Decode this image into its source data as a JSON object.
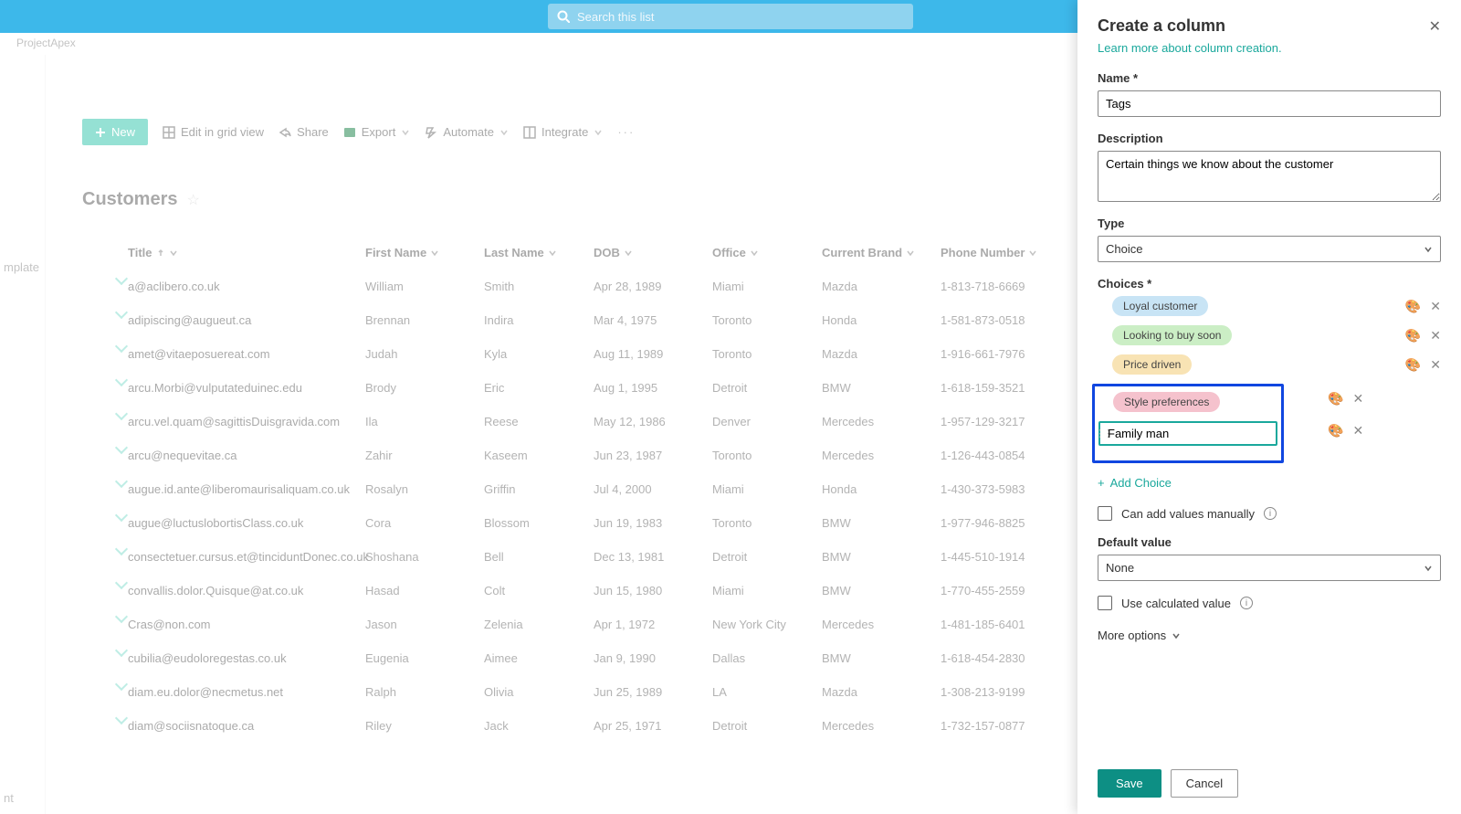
{
  "topbar": {
    "search_placeholder": "Search this list"
  },
  "breadcrumb": "ProjectApex",
  "left": {
    "mplate": "mplate",
    "nt": "nt"
  },
  "toolbar": {
    "new": "New",
    "grid": "Edit in grid view",
    "share": "Share",
    "export": "Export",
    "automate": "Automate",
    "integrate": "Integrate"
  },
  "list_heading": "Customers",
  "columns": [
    "Title",
    "First Name",
    "Last Name",
    "DOB",
    "Office",
    "Current Brand",
    "Phone Number"
  ],
  "rows": [
    {
      "title": "a@aclibero.co.uk",
      "fn": "William",
      "ln": "Smith",
      "dob": "Apr 28, 1989",
      "office": "Miami",
      "brand": "Mazda",
      "phone": "1-813-718-6669"
    },
    {
      "title": "adipiscing@augueut.ca",
      "fn": "Brennan",
      "ln": "Indira",
      "dob": "Mar 4, 1975",
      "office": "Toronto",
      "brand": "Honda",
      "phone": "1-581-873-0518"
    },
    {
      "title": "amet@vitaeposuereat.com",
      "fn": "Judah",
      "ln": "Kyla",
      "dob": "Aug 11, 1989",
      "office": "Toronto",
      "brand": "Mazda",
      "phone": "1-916-661-7976"
    },
    {
      "title": "arcu.Morbi@vulputateduinec.edu",
      "fn": "Brody",
      "ln": "Eric",
      "dob": "Aug 1, 1995",
      "office": "Detroit",
      "brand": "BMW",
      "phone": "1-618-159-3521"
    },
    {
      "title": "arcu.vel.quam@sagittisDuisgravida.com",
      "fn": "Ila",
      "ln": "Reese",
      "dob": "May 12, 1986",
      "office": "Denver",
      "brand": "Mercedes",
      "phone": "1-957-129-3217"
    },
    {
      "title": "arcu@nequevitae.ca",
      "fn": "Zahir",
      "ln": "Kaseem",
      "dob": "Jun 23, 1987",
      "office": "Toronto",
      "brand": "Mercedes",
      "phone": "1-126-443-0854"
    },
    {
      "title": "augue.id.ante@liberomaurisaliquam.co.uk",
      "fn": "Rosalyn",
      "ln": "Griffin",
      "dob": "Jul 4, 2000",
      "office": "Miami",
      "brand": "Honda",
      "phone": "1-430-373-5983"
    },
    {
      "title": "augue@luctuslobortisClass.co.uk",
      "fn": "Cora",
      "ln": "Blossom",
      "dob": "Jun 19, 1983",
      "office": "Toronto",
      "brand": "BMW",
      "phone": "1-977-946-8825"
    },
    {
      "title": "consectetuer.cursus.et@tinciduntDonec.co.uk",
      "fn": "Shoshana",
      "ln": "Bell",
      "dob": "Dec 13, 1981",
      "office": "Detroit",
      "brand": "BMW",
      "phone": "1-445-510-1914"
    },
    {
      "title": "convallis.dolor.Quisque@at.co.uk",
      "fn": "Hasad",
      "ln": "Colt",
      "dob": "Jun 15, 1980",
      "office": "Miami",
      "brand": "BMW",
      "phone": "1-770-455-2559"
    },
    {
      "title": "Cras@non.com",
      "fn": "Jason",
      "ln": "Zelenia",
      "dob": "Apr 1, 1972",
      "office": "New York City",
      "brand": "Mercedes",
      "phone": "1-481-185-6401"
    },
    {
      "title": "cubilia@eudoloregestas.co.uk",
      "fn": "Eugenia",
      "ln": "Aimee",
      "dob": "Jan 9, 1990",
      "office": "Dallas",
      "brand": "BMW",
      "phone": "1-618-454-2830"
    },
    {
      "title": "diam.eu.dolor@necmetus.net",
      "fn": "Ralph",
      "ln": "Olivia",
      "dob": "Jun 25, 1989",
      "office": "LA",
      "brand": "Mazda",
      "phone": "1-308-213-9199"
    },
    {
      "title": "diam@sociisnatoque.ca",
      "fn": "Riley",
      "ln": "Jack",
      "dob": "Apr 25, 1971",
      "office": "Detroit",
      "brand": "Mercedes",
      "phone": "1-732-157-0877"
    }
  ],
  "panel": {
    "title": "Create a column",
    "learn": "Learn more about column creation.",
    "name_label": "Name *",
    "name_value": "Tags",
    "desc_label": "Description",
    "desc_value": "Certain things we know about the customer",
    "type_label": "Type",
    "type_value": "Choice",
    "choices_label": "Choices *",
    "choices": [
      {
        "text": "Loyal customer",
        "cls": "blue"
      },
      {
        "text": "Looking to buy soon",
        "cls": "green"
      },
      {
        "text": "Price driven",
        "cls": "yellow"
      },
      {
        "text": "Style preferences",
        "cls": "pink"
      }
    ],
    "editing_choice": "Family man",
    "add_choice": "Add Choice",
    "manual_label": "Can add values manually",
    "default_label": "Default value",
    "default_value": "None",
    "calc_label": "Use calculated value",
    "more_opts": "More options",
    "save": "Save",
    "cancel": "Cancel"
  }
}
